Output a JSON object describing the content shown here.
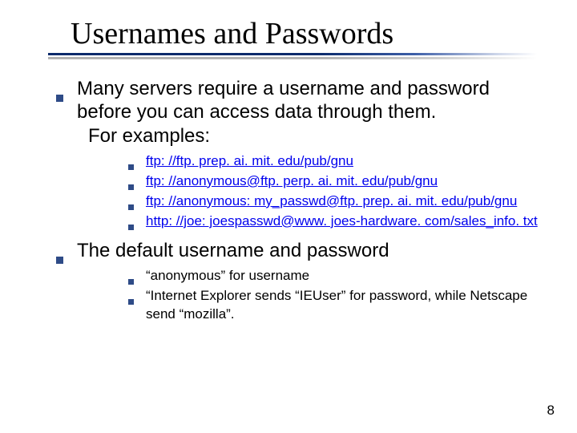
{
  "title": "Usernames and Passwords",
  "bullets": {
    "b1_line1": "Many servers require a username and password",
    "b1_line2": "before you can access data through them.",
    "b1_line3": "For examples:",
    "links": {
      "l1": "ftp: //ftp. prep. ai. mit. edu/pub/gnu",
      "l2": "ftp: //anonymous@ftp. perp. ai. mit. edu/pub/gnu",
      "l3": "ftp: //anonymous: my_passwd@ftp. prep. ai. mit. edu/pub/gnu",
      "l4": "http: //joe: joespasswd@www. joes-hardware. com/sales_info. txt"
    },
    "b2": "The default username and password",
    "sub2": {
      "s1": "“anonymous” for username",
      "s2": "“Internet Explorer sends “IEUser” for password, while Netscape send “mozilla”."
    }
  },
  "page_number": "8"
}
